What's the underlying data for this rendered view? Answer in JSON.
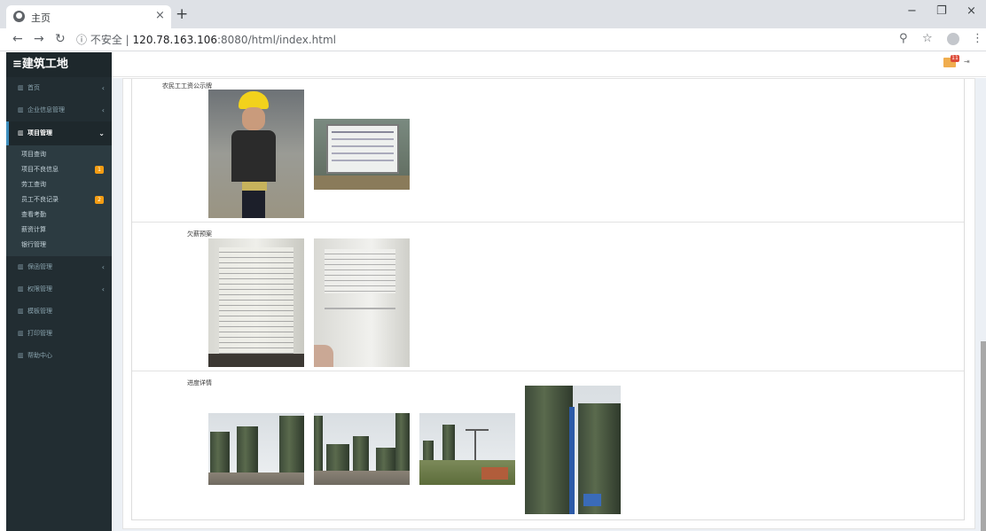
{
  "browser": {
    "tab_title": "主页",
    "tab_close": "×",
    "new_tab": "+",
    "url_insecure": "不安全",
    "url_separator": "|",
    "url_host": "120.78.163.106",
    "url_rest": ":8080/html/index.html",
    "window_minimize": "−",
    "window_restore": "❐",
    "window_close": "×"
  },
  "app": {
    "brand": "≡建筑工地"
  },
  "sidebar": {
    "items": [
      {
        "label": "首页",
        "icon": "chart-icon",
        "has_chevron": true
      },
      {
        "label": "企业信息管理",
        "icon": "chart-icon",
        "has_chevron": true
      },
      {
        "label": "项目管理",
        "icon": "chart-icon",
        "has_chevron": true,
        "active": true
      },
      {
        "label": "保函管理",
        "icon": "chart-icon",
        "has_chevron": true
      },
      {
        "label": "权限管理",
        "icon": "chart-icon",
        "has_chevron": true
      },
      {
        "label": "模板管理",
        "icon": "chart-icon",
        "has_chevron": false
      },
      {
        "label": "打印管理",
        "icon": "chart-icon",
        "has_chevron": false
      },
      {
        "label": "帮助中心",
        "icon": "chart-icon",
        "has_chevron": false
      }
    ],
    "submenu": [
      {
        "label": "项目查询"
      },
      {
        "label": "项目不良信息",
        "badge": "1"
      },
      {
        "label": "劳工查询"
      },
      {
        "label": "员工不良记录",
        "badge": "2"
      },
      {
        "label": "查看考勤"
      },
      {
        "label": "薪资计算"
      },
      {
        "label": "银行管理"
      }
    ]
  },
  "header": {
    "notification_badge": "11"
  },
  "sections": [
    {
      "label": "农民工工资公示牌"
    },
    {
      "label": "欠薪预案"
    },
    {
      "label": "进度详情"
    }
  ],
  "colors": {
    "sidebar_bg": "#222d32",
    "sidebar_active_border": "#3c8dbc",
    "badge": "#f39c12"
  }
}
